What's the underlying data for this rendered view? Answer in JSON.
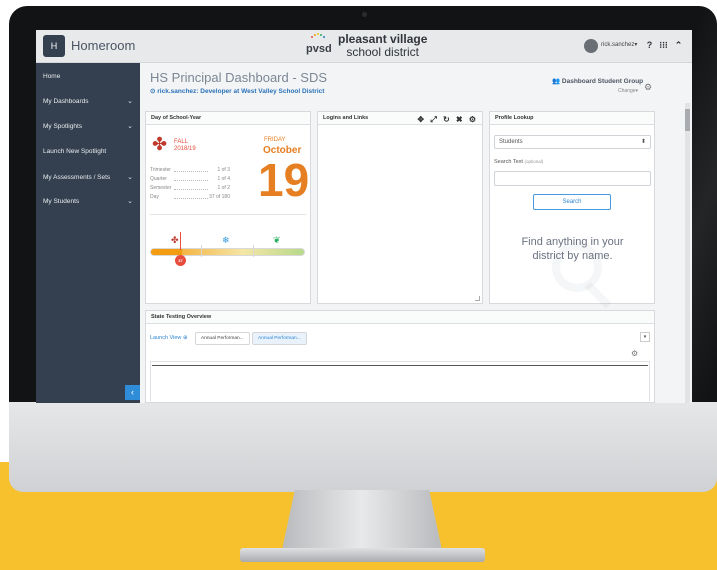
{
  "app": {
    "name": "Homeroom",
    "logo_letter": "H",
    "brand_short": "pvsd",
    "district_line1": "pleasant village",
    "district_line2": "school district"
  },
  "user": {
    "name": "rick.sanchez",
    "caret": "▾"
  },
  "sidebar": {
    "items": [
      {
        "label": "Home",
        "has_chevron": false
      },
      {
        "label": "My Dashboards",
        "has_chevron": true
      },
      {
        "label": "My Spotlights",
        "has_chevron": true
      },
      {
        "label": "Launch New Spotlight",
        "has_chevron": false
      },
      {
        "label": "My Assessments / Sets",
        "has_chevron": true
      },
      {
        "label": "My Students",
        "has_chevron": true
      }
    ],
    "chevron": "⌄",
    "collapse_glyph": "‹"
  },
  "dashboard": {
    "title": "HS Principal Dashboard - SDS",
    "subtitle": "rick.sanchez: Developer at West Valley School District",
    "group_label": "Dashboard Student Group",
    "group_change": "Change"
  },
  "day_panel": {
    "title": "Day of School-Year",
    "season": "FALL",
    "year": "2018/19",
    "weekday": "FRIDAY",
    "month": "October",
    "day_number": "19",
    "stats": [
      {
        "label": "Trimester",
        "value": "1 of 3"
      },
      {
        "label": "Quarter",
        "value": "1 of 4"
      },
      {
        "label": "Semester",
        "value": "1 of 2"
      },
      {
        "label": "Day",
        "value": "37 of 180"
      }
    ],
    "timeline_marker": "37",
    "progress_fraction": 0.2056
  },
  "logins_panel": {
    "title": "Logins and Links",
    "tools": [
      "✥",
      "⤢",
      "↻",
      "✖",
      "⚙"
    ]
  },
  "profile_panel": {
    "title": "Profile Lookup",
    "select_value": "Students",
    "search_label": "Search Text",
    "search_optional": "(optional)",
    "search_button": "Search",
    "find_text": "Find anything in your district by name."
  },
  "state_panel": {
    "title": "State Testing Overview",
    "launch_view": "Launch View",
    "tabs": [
      "Annual Performan...",
      "Annual Performan..."
    ]
  },
  "colors": {
    "sidebar_bg": "#34404f",
    "accent_blue": "#2e86d4",
    "accent_orange": "#e67e22",
    "floor_yellow": "#f7c12e"
  }
}
